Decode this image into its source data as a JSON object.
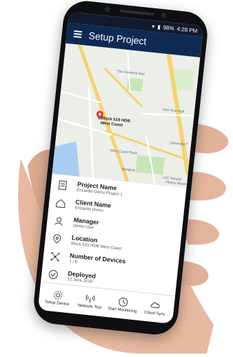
{
  "status": {
    "battery": "98%",
    "time": "4:28 PM"
  },
  "appbar": {
    "title": "Setup Project"
  },
  "map": {
    "pin_label_line1": "Block 519 HDB",
    "pin_label_line2": "West Coast",
    "labels": {
      "mall": "The Clementi Mall",
      "nan_hua": "Nan Hua High",
      "coast_plaza": "West Coast Plaza",
      "university": "University T",
      "bangkok": "Bangkok",
      "lkc": "LKC Natural",
      "museum": "History Museum"
    }
  },
  "details": {
    "project": {
      "title": "Project Name",
      "value": "Encardio Demo Project 1"
    },
    "client": {
      "title": "Client Name",
      "value": "Encardio Demo"
    },
    "manager": {
      "title": "Manager",
      "value": "Demo User"
    },
    "location": {
      "title": "Location",
      "value": "Block 519 HDB West Coast"
    },
    "devices": {
      "title": "Number of Devices",
      "value": "1 / 6"
    },
    "deployed": {
      "title": "Deployed",
      "value": "12 June 2018"
    }
  },
  "bottomnav": {
    "setup": "Setup Device",
    "network": "Network Test",
    "monitoring": "Start Monitoring",
    "cloud": "Cloud Sync"
  },
  "colors": {
    "appbar": "#0f2a52",
    "statusbar": "#121a2e",
    "pin": "#e53935"
  }
}
